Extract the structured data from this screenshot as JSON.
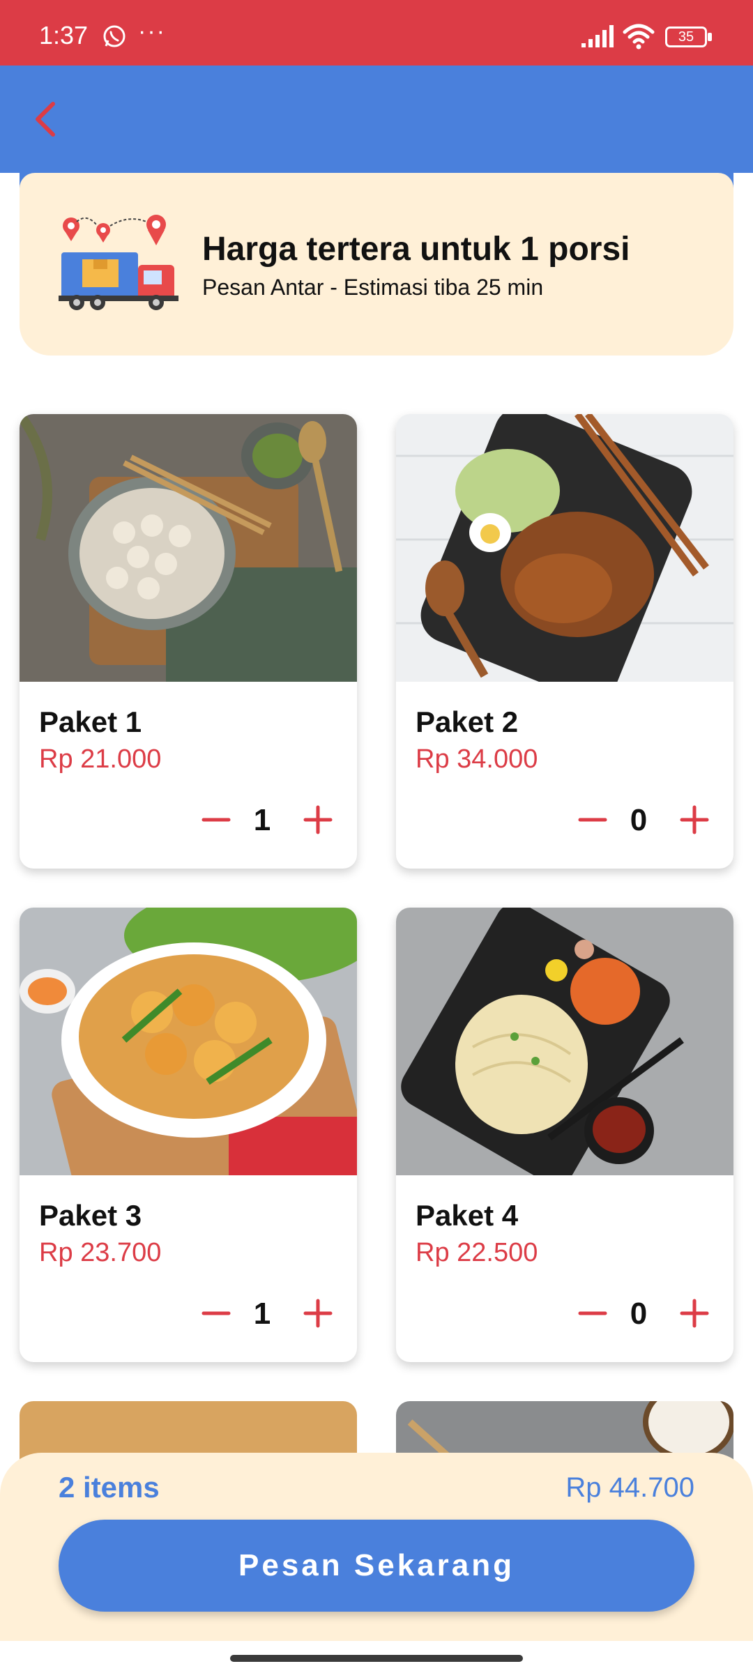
{
  "status_bar": {
    "time": "1:37",
    "dots": "···",
    "battery": "35"
  },
  "banner": {
    "title": "Harga tertera untuk 1 porsi",
    "subtitle": "Pesan Antar - Estimasi tiba 25 min"
  },
  "products": [
    {
      "name": "Paket 1",
      "price": "Rp 21.000",
      "qty": "1",
      "image": "meatball-noodle-soup-photo"
    },
    {
      "name": "Paket 2",
      "price": "Rp 34.000",
      "qty": "0",
      "image": "teriyaki-bento-box-photo"
    },
    {
      "name": "Paket 3",
      "price": "Rp 23.700",
      "qty": "1",
      "image": "fried-tofu-bowl-photo"
    },
    {
      "name": "Paket 4",
      "price": "Rp 22.500",
      "qty": "0",
      "image": "noodle-bento-box-photo"
    }
  ],
  "cart": {
    "items_count": "2 items",
    "total": "Rp 44.700",
    "order_label": "Pesan Sekarang"
  },
  "colors": {
    "status_bar": "#dc3c46",
    "app_bar": "#4a80dc",
    "accent_red": "#dc3c46",
    "banner_bg": "#fff0d7",
    "button": "#4a80dc"
  }
}
